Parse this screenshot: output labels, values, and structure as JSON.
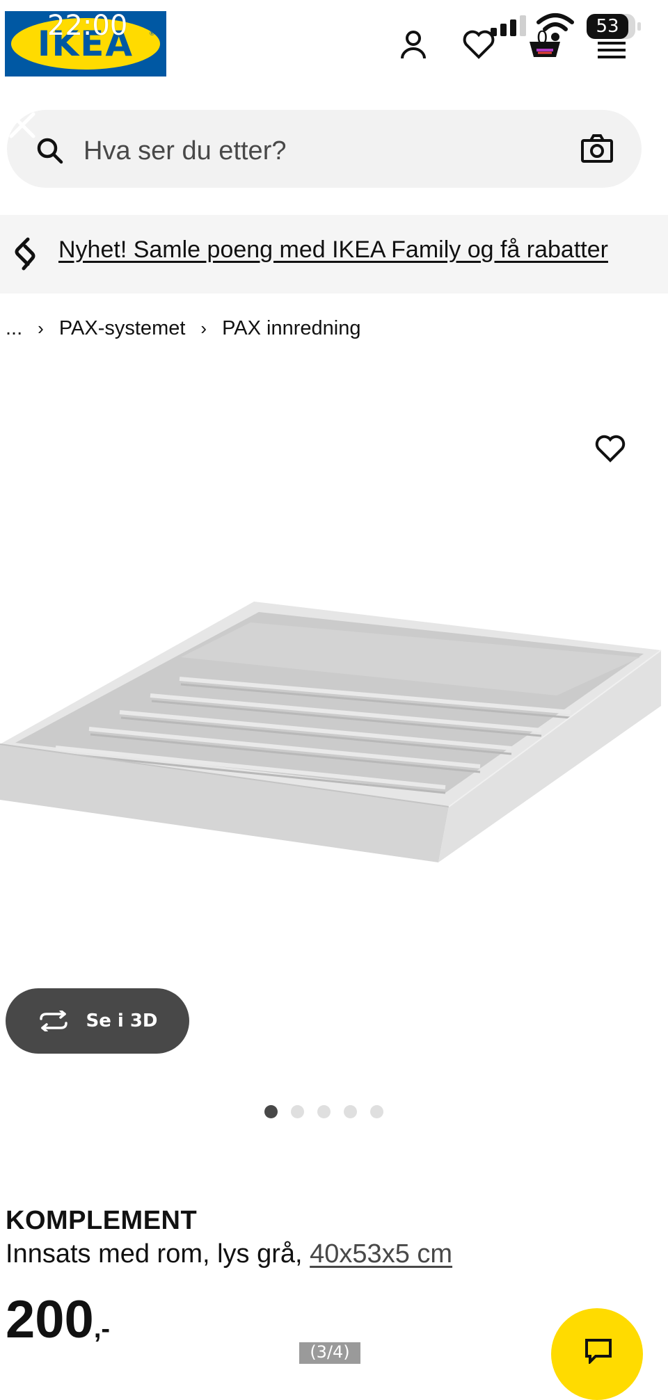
{
  "status_bar": {
    "time": "22:00",
    "battery": "53"
  },
  "header": {
    "logo_text": "IKEA",
    "logo_mark": "®",
    "cart_count": "0",
    "icons": [
      "person-icon",
      "heart-icon",
      "cart-icon",
      "menu-icon"
    ]
  },
  "search": {
    "placeholder": "Hva ser du etter?",
    "value": ""
  },
  "banner": {
    "link_text": "Nyhet! Samle poeng med IKEA Family og få rabatter"
  },
  "breadcrumb": {
    "ellipsis": "...",
    "items": [
      "PAX-systemet",
      "PAX innredning"
    ]
  },
  "gallery": {
    "button_3d": "Se i 3D",
    "dot_count": 5,
    "active_dot": 1
  },
  "product": {
    "name": "KOMPLEMENT",
    "description": "Innsats med rom, lys grå, ",
    "dimensions": "40x53x5 cm",
    "price": "200",
    "price_suffix": ",-"
  },
  "overlay": {
    "page_indicator": "(3/4)"
  },
  "colors": {
    "ikea_blue": "#0058a3",
    "ikea_yellow": "#ffdb00",
    "dark_button": "#484848"
  }
}
